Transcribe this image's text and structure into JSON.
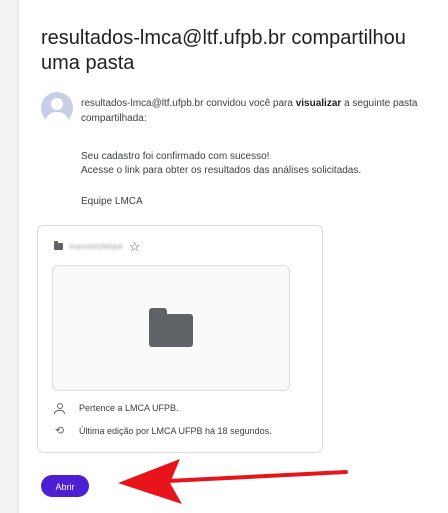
{
  "email": {
    "title": "resultados-lmca@ltf.ufpb.br compartilhou uma pasta",
    "invite": {
      "sender": "resultados-lmca@ltf.ufpb.br",
      "text_before": " convidou você para ",
      "action": "visualizar",
      "text_after": " a seguinte pasta compartilhada:"
    },
    "message_lines": [
      "Seu cadastro foi confirmado com sucesso!",
      "Acesse o link para obter os resultados das análises solicitadas."
    ],
    "signature": "Equipe LMCA",
    "folder": {
      "name": "manoelofelipe",
      "star_icon": "star-outline-icon",
      "owner": "Pertence a LMCA UFPB.",
      "last_edit": "Última edição por LMCA UFPB há 18 segundos."
    },
    "open_button": "Abrir"
  },
  "colors": {
    "button": "#4c1fd4",
    "arrow": "#e8141b"
  }
}
